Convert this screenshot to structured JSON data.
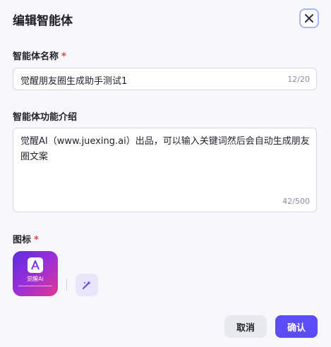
{
  "dialog": {
    "title": "编辑智能体",
    "close_icon": "close-icon"
  },
  "name_field": {
    "label": "智能体名称",
    "required_mark": "*",
    "value": "觉醒朋友圈生成助手测试1",
    "counter": "12/20"
  },
  "description_field": {
    "label": "智能体功能介绍",
    "value": "觉醒AI（www.juexing.ai）出品，可以输入关键词然后会自动生成朋友圈文案",
    "counter": "42/500"
  },
  "icon_field": {
    "label": "图标",
    "required_mark": "*",
    "avatar_brand": "觉醒Ai",
    "generate_icon": "sparkle-magic-icon"
  },
  "footer": {
    "cancel_label": "取消",
    "confirm_label": "确认"
  },
  "colors": {
    "primary": "#5b4cf5",
    "required": "#f23c3c"
  }
}
